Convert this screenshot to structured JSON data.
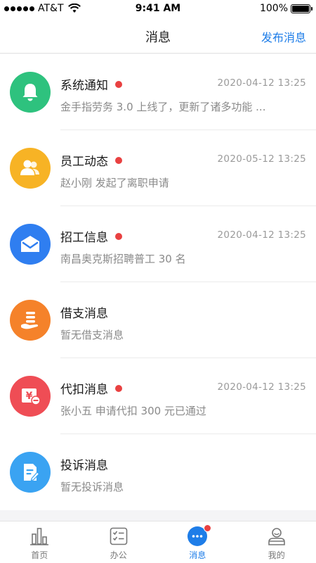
{
  "status_bar": {
    "carrier": "AT&T",
    "time": "9:41 AM",
    "battery": "100%"
  },
  "nav": {
    "title": "消息",
    "action_label": "发布消息"
  },
  "messages": [
    {
      "title": "系统通知",
      "time": "2020-04-12 13:25",
      "preview": "金手指劳务 3.0 上线了，更新了诸多功能 ...",
      "unread": true,
      "icon": "bell-icon",
      "color": "#2ec27e"
    },
    {
      "title": "员工动态",
      "time": "2020-05-12 13:25",
      "preview": "赵小刚 发起了离职申请",
      "unread": true,
      "icon": "people-icon",
      "color": "#f7b325"
    },
    {
      "title": "招工信息",
      "time": "2020-04-12 13:25",
      "preview": "南昌奥克斯招聘普工 30 名",
      "unread": true,
      "icon": "envelope-icon",
      "color": "#2f7ef0"
    },
    {
      "title": "借支消息",
      "time": "",
      "preview": "暂无借支消息",
      "unread": false,
      "icon": "coins-hand-icon",
      "color": "#f5822a"
    },
    {
      "title": "代扣消息",
      "time": "2020-04-12 13:25",
      "preview": "张小五 申请代扣 300 元已通过",
      "unread": true,
      "icon": "yen-deduct-icon",
      "color": "#ef4d55"
    },
    {
      "title": "投诉消息",
      "time": "",
      "preview": "暂无投诉消息",
      "unread": false,
      "icon": "document-edit-icon",
      "color": "#3aa3f2"
    }
  ],
  "tabs": [
    {
      "label": "首页",
      "icon": "bar-chart-icon",
      "active": false
    },
    {
      "label": "办公",
      "icon": "checklist-icon",
      "active": false
    },
    {
      "label": "消息",
      "icon": "chat-bubble-icon",
      "active": true,
      "badge": true
    },
    {
      "label": "我的",
      "icon": "user-icon",
      "active": false
    }
  ],
  "colors": {
    "accent": "#1e7de8",
    "unread_dot": "#e94141"
  }
}
